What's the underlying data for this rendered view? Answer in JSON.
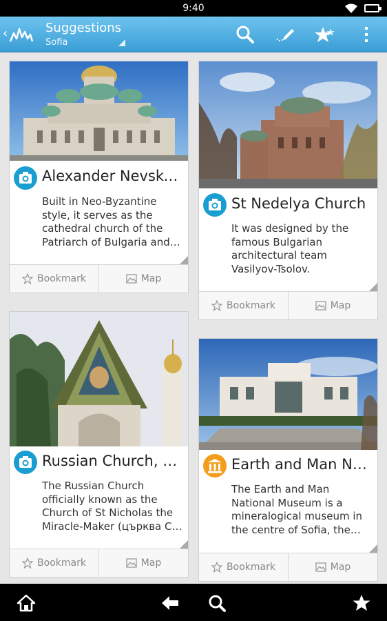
{
  "status_bar": {
    "time": "9:40"
  },
  "action_bar": {
    "title": "Suggestions",
    "subtitle": "Sofia",
    "icons": [
      "back-arrow-icon",
      "app-logo-icon",
      "search-icon",
      "edit-icon",
      "stars-icon",
      "overflow-menu-icon"
    ]
  },
  "cards": [
    {
      "title": "Alexander Nevsky Cathedral",
      "description": "Built in Neo-Byzantine style, it serves as the cathedral church of the Patriarch of Bulgaria and one of the largest Eastern Orthodox cathedrals in the world.",
      "type_icon": "camera-icon",
      "bookmark_label": "Bookmark",
      "map_label": "Map"
    },
    {
      "title": "St Nedelya Church",
      "description": "It was designed by the famous Bulgarian architectural team Vasilyov-Tsolov.",
      "type_icon": "camera-icon",
      "bookmark_label": "Bookmark",
      "map_label": "Map"
    },
    {
      "title": "Russian Church, St Nicholas",
      "description": "The Russian Church officially known as the Church of St Nicholas the Miracle-Maker (църква Св. Николай Чудотворец)",
      "type_icon": "camera-icon",
      "bookmark_label": "Bookmark",
      "map_label": "Map"
    },
    {
      "title": "Earth and Man National Museum",
      "description": "The Earth and Man National Museum is a mineralogical museum in the centre of Sofia, the capital of Bulgaria.",
      "type_icon": "museum-icon",
      "bookmark_label": "Bookmark",
      "map_label": "Map"
    }
  ],
  "nav_bar": {
    "icons": [
      "home-icon",
      "back-icon",
      "search-icon",
      "favorites-star-icon"
    ]
  },
  "colors": {
    "action_bar": "#3a9ed6",
    "camera_badge": "#1a9dd1",
    "museum_badge": "#f29e1c"
  }
}
